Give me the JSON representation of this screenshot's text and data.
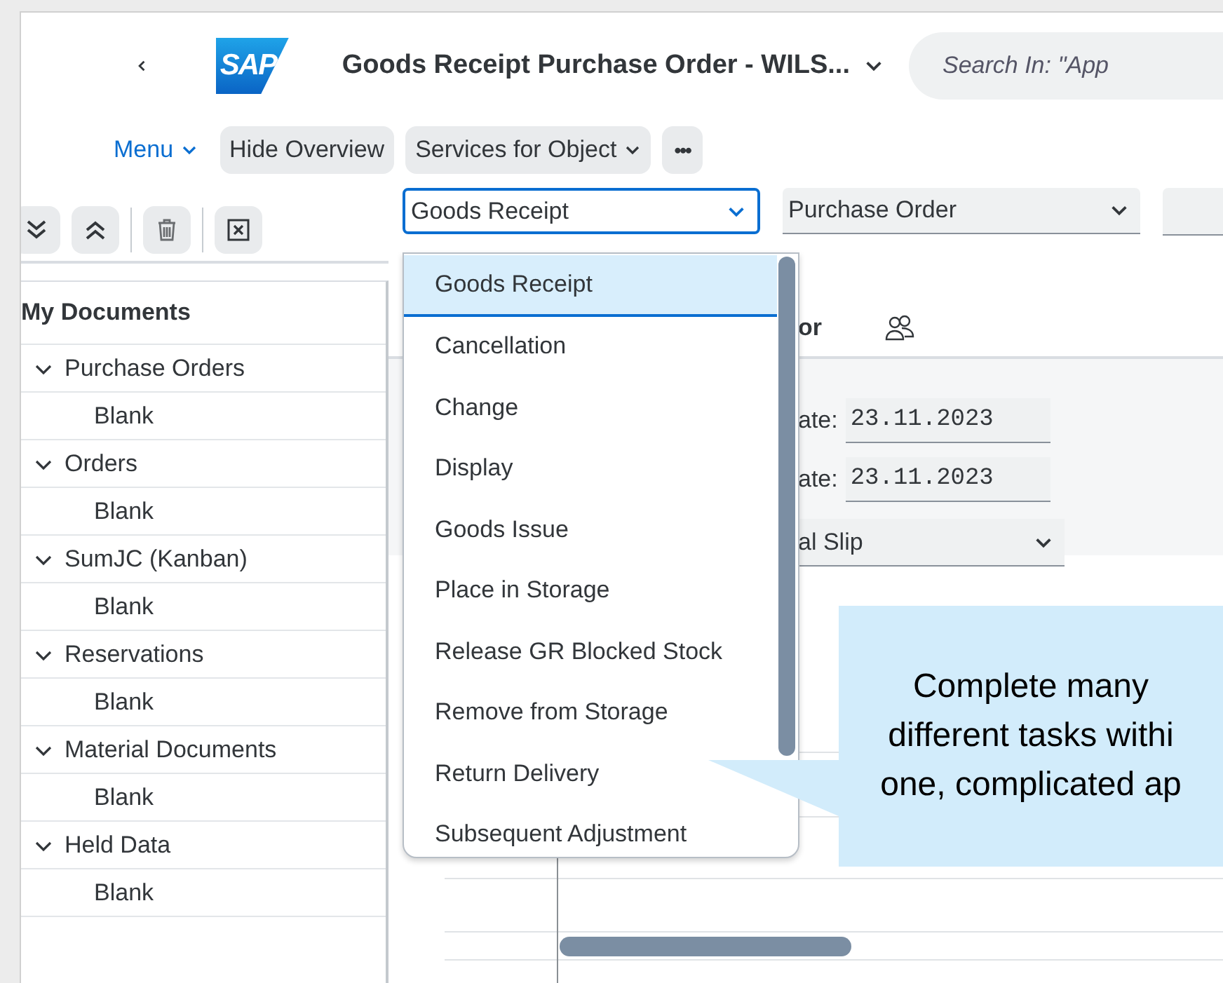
{
  "header": {
    "logo": "SAP",
    "title": "Goods Receipt Purchase Order - WILS...",
    "search": {
      "placeholder": "Search In: \"App"
    }
  },
  "toolbar": {
    "menu": "Menu",
    "buttons": [
      {
        "label": "Hide Overview",
        "kind": "plain"
      },
      {
        "label": "Services for Object",
        "kind": "menu"
      },
      {
        "label": "•••",
        "kind": "more"
      }
    ]
  },
  "tree": {
    "title": "My Documents",
    "items": [
      {
        "label": "Purchase Orders",
        "expanded": true,
        "children": [
          {
            "label": "Blank"
          }
        ]
      },
      {
        "label": "Orders",
        "expanded": true,
        "children": [
          {
            "label": "Blank"
          }
        ]
      },
      {
        "label": "SumJC (Kanban)",
        "expanded": true,
        "children": [
          {
            "label": "Blank"
          }
        ]
      },
      {
        "label": "Reservations",
        "expanded": true,
        "children": [
          {
            "label": "Blank"
          }
        ]
      },
      {
        "label": "Material Documents",
        "expanded": true,
        "children": [
          {
            "label": "Blank"
          }
        ]
      },
      {
        "label": "Held Data",
        "expanded": true,
        "children": [
          {
            "label": "Blank"
          }
        ]
      }
    ]
  },
  "selectors": [
    {
      "value": "Goods Receipt",
      "focused": true
    },
    {
      "value": "Purchase Order",
      "focused": false
    }
  ],
  "dropdown": {
    "items": [
      {
        "label": "Goods Receipt",
        "selected": true
      },
      {
        "label": "Cancellation",
        "selected": false
      },
      {
        "label": "Change",
        "selected": false
      },
      {
        "label": "Display",
        "selected": false
      },
      {
        "label": "Goods Issue",
        "selected": false
      },
      {
        "label": "Place in Storage",
        "selected": false
      },
      {
        "label": "Release GR Blocked Stock",
        "selected": false
      },
      {
        "label": "Remove from Storage",
        "selected": false
      },
      {
        "label": "Return Delivery",
        "selected": false
      },
      {
        "label": "Subsequent Adjustment",
        "selected": false
      }
    ]
  },
  "tab": {
    "label": "or"
  },
  "form": {
    "fields": [
      {
        "kind": "date",
        "label": "ate:",
        "value": "23.11.2023"
      },
      {
        "kind": "date",
        "label": "ate:",
        "value": "23.11.2023"
      },
      {
        "kind": "select",
        "value": "al Slip"
      }
    ]
  },
  "callout": {
    "lines": [
      "Complete many",
      "different tasks withi",
      "one, complicated ap"
    ]
  }
}
